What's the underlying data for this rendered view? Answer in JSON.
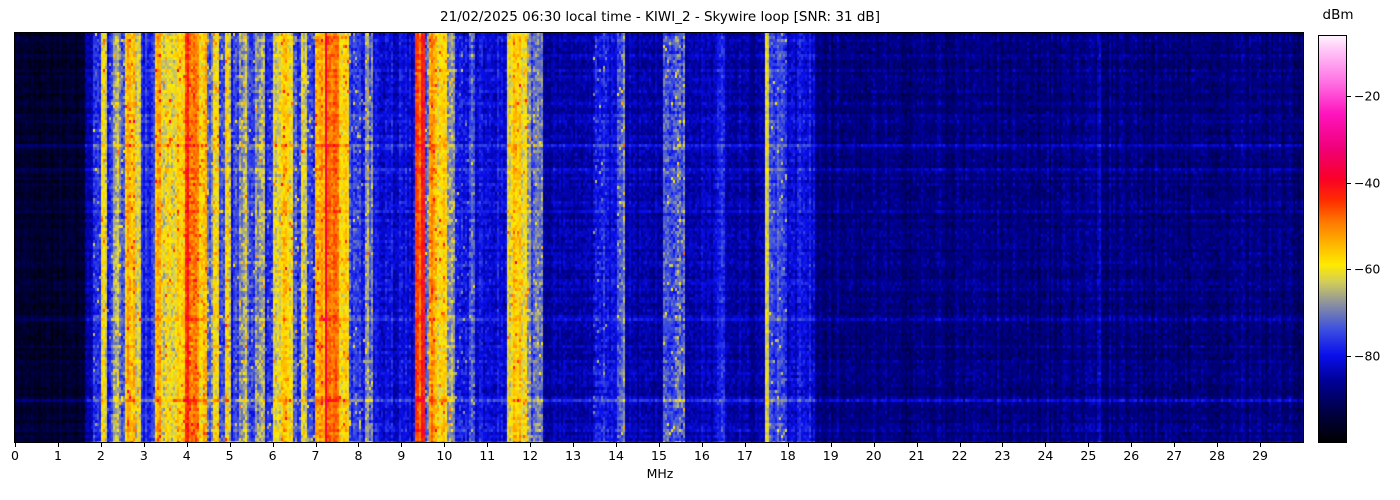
{
  "chart_data": {
    "type": "heatmap",
    "title": "21/02/2025 06:30 local time - KIWI_2 - Skywire loop [SNR: 31 dB]",
    "datetime_local": "21/02/2025 06:30",
    "station": "KIWI_2",
    "antenna": "Skywire loop",
    "snr_db": 31,
    "xlabel": "MHz",
    "ylabel": "",
    "x_range_mhz": [
      0,
      30
    ],
    "x_ticks": [
      0,
      1,
      2,
      3,
      4,
      5,
      6,
      7,
      8,
      9,
      10,
      11,
      12,
      13,
      14,
      15,
      16,
      17,
      18,
      19,
      20,
      21,
      22,
      23,
      24,
      25,
      26,
      27,
      28,
      29
    ],
    "grid": false,
    "colorbar": {
      "label": "dBm",
      "range_dbm": [
        -100,
        -6
      ],
      "ticks": [
        {
          "label": "−20",
          "value": -20
        },
        {
          "label": "−40",
          "value": -40
        },
        {
          "label": "−60",
          "value": -60
        },
        {
          "label": "−80",
          "value": -80
        }
      ],
      "colormap_stops": [
        [
          -100,
          0,
          0,
          0
        ],
        [
          -93,
          0,
          0,
          70
        ],
        [
          -86,
          0,
          0,
          150
        ],
        [
          -80,
          10,
          15,
          235
        ],
        [
          -74,
          60,
          80,
          225
        ],
        [
          -68,
          140,
          145,
          160
        ],
        [
          -63,
          210,
          205,
          90
        ],
        [
          -59,
          255,
          235,
          0
        ],
        [
          -54,
          255,
          180,
          0
        ],
        [
          -49,
          255,
          120,
          0
        ],
        [
          -44,
          255,
          45,
          0
        ],
        [
          -39,
          250,
          0,
          40
        ],
        [
          -32,
          240,
          0,
          120
        ],
        [
          -24,
          255,
          20,
          190
        ],
        [
          -16,
          255,
          120,
          230
        ],
        [
          -9,
          255,
          200,
          248
        ],
        [
          -5,
          255,
          255,
          255
        ]
      ]
    },
    "noise_floor_dbm": -88,
    "bands_dbm": [
      [
        0.0,
        1.62,
        -95,
        3
      ],
      [
        1.62,
        1.8,
        -85,
        4
      ],
      [
        1.8,
        2.0,
        -77,
        6
      ],
      [
        2.0,
        2.12,
        -63,
        6
      ],
      [
        2.12,
        2.28,
        -78,
        6
      ],
      [
        2.28,
        2.44,
        -65,
        7
      ],
      [
        2.44,
        2.56,
        -72,
        7
      ],
      [
        2.56,
        2.78,
        -55,
        6
      ],
      [
        2.78,
        2.92,
        -63,
        6
      ],
      [
        2.92,
        3.26,
        -77,
        5
      ],
      [
        3.26,
        3.42,
        -52,
        6
      ],
      [
        3.42,
        3.56,
        -62,
        7
      ],
      [
        3.56,
        3.76,
        -60,
        7
      ],
      [
        3.76,
        3.97,
        -55,
        6
      ],
      [
        3.97,
        4.05,
        -44,
        5
      ],
      [
        4.05,
        4.3,
        -50,
        6
      ],
      [
        4.3,
        4.46,
        -58,
        7
      ],
      [
        4.46,
        4.6,
        -70,
        7
      ],
      [
        4.6,
        4.76,
        -62,
        7
      ],
      [
        4.76,
        4.9,
        -75,
        6
      ],
      [
        4.9,
        5.04,
        -61,
        8
      ],
      [
        5.04,
        5.2,
        -77,
        6
      ],
      [
        5.2,
        5.42,
        -65,
        8
      ],
      [
        5.42,
        5.58,
        -75,
        7
      ],
      [
        5.58,
        5.82,
        -66,
        8
      ],
      [
        5.82,
        6.0,
        -77,
        6
      ],
      [
        6.0,
        6.24,
        -61,
        6
      ],
      [
        6.24,
        6.46,
        -57,
        6
      ],
      [
        6.46,
        6.64,
        -75,
        7
      ],
      [
        6.64,
        6.8,
        -64,
        7
      ],
      [
        6.8,
        7.0,
        -77,
        6
      ],
      [
        7.0,
        7.2,
        -55,
        6
      ],
      [
        7.2,
        7.28,
        -40,
        4
      ],
      [
        7.28,
        7.56,
        -49,
        5
      ],
      [
        7.56,
        7.8,
        -59,
        6
      ],
      [
        7.8,
        8.16,
        -76,
        6
      ],
      [
        8.16,
        8.34,
        -69,
        7
      ],
      [
        8.34,
        9.34,
        -81,
        5
      ],
      [
        9.34,
        9.46,
        -47,
        5
      ],
      [
        9.46,
        9.53,
        -42,
        4
      ],
      [
        9.53,
        9.64,
        -71,
        7
      ],
      [
        9.64,
        9.8,
        -52,
        6
      ],
      [
        9.8,
        10.04,
        -58,
        6
      ],
      [
        10.04,
        10.24,
        -67,
        7
      ],
      [
        10.24,
        10.56,
        -80,
        6
      ],
      [
        10.56,
        10.7,
        -73,
        7
      ],
      [
        10.7,
        11.48,
        -81,
        5
      ],
      [
        11.48,
        11.6,
        -62,
        6
      ],
      [
        11.6,
        11.78,
        -56,
        6
      ],
      [
        11.78,
        11.92,
        -63,
        6
      ],
      [
        11.92,
        12.32,
        -72,
        7
      ],
      [
        12.32,
        13.48,
        -85,
        4
      ],
      [
        13.48,
        13.78,
        -78,
        6
      ],
      [
        13.78,
        14.02,
        -81,
        5
      ],
      [
        14.02,
        14.2,
        -73,
        7
      ],
      [
        14.2,
        15.08,
        -85,
        4
      ],
      [
        15.08,
        15.38,
        -76,
        7
      ],
      [
        15.38,
        15.62,
        -70,
        9
      ],
      [
        15.62,
        16.32,
        -84,
        4
      ],
      [
        16.32,
        16.52,
        -79,
        5
      ],
      [
        16.52,
        17.46,
        -85,
        4
      ],
      [
        17.46,
        17.58,
        -61,
        4
      ],
      [
        17.58,
        17.98,
        -75,
        6
      ],
      [
        17.98,
        18.62,
        -81,
        5
      ],
      [
        18.62,
        25.2,
        -88,
        4
      ],
      [
        25.2,
        25.3,
        -82,
        4
      ],
      [
        25.3,
        30.0,
        -88,
        4
      ]
    ],
    "time_event_rows": [
      [
        0.093,
        3
      ],
      [
        0.276,
        4
      ],
      [
        0.335,
        3
      ],
      [
        0.435,
        4
      ],
      [
        0.7,
        2.5
      ],
      [
        0.9,
        6
      ],
      [
        0.975,
        4
      ],
      [
        0.998,
        5
      ]
    ]
  }
}
